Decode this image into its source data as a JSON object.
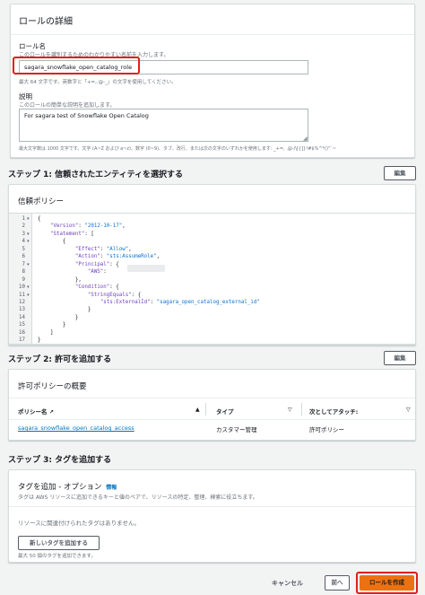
{
  "role_details": {
    "title": "ロールの詳細",
    "role_name_label": "ロール名",
    "role_name_desc": "このロールを識別するためのわかりやすい名前を入力します。",
    "role_name_value": "sagara_snowflake_open_catalog_role",
    "role_name_hint": "最大 64 文字です。英数字と「+=,.@-_」の文字を使用してください。",
    "description_label": "説明",
    "description_desc": "このロールの簡単な説明を追加します。",
    "description_value": "For sagara test of Snowflake Open Catalog",
    "description_hint": "最大文字数は 1000 文字です。文字 (A~Z および a~z)、数字 (0~9)、タブ、改行、または次の文字のいずれかを使用します: _+=, .@-/\\[{]}!#$%^*()\"`~"
  },
  "step1": {
    "title": "ステップ 1: 信頼されたエンティティを選択する",
    "edit_label": "編集",
    "trust_policy_title": "信頼ポリシー",
    "code_lines": [
      {
        "n": "1",
        "fold": true,
        "text": "{"
      },
      {
        "n": "2",
        "fold": false,
        "text": "    \"Version\": \"2012-10-17\","
      },
      {
        "n": "3",
        "fold": true,
        "text": "    \"Statement\": ["
      },
      {
        "n": "4",
        "fold": true,
        "text": "        {"
      },
      {
        "n": "5",
        "fold": false,
        "text": "            \"Effect\": \"Allow\","
      },
      {
        "n": "6",
        "fold": false,
        "text": "            \"Action\": \"sts:AssumeRole\","
      },
      {
        "n": "7",
        "fold": true,
        "text": "            \"Principal\": {"
      },
      {
        "n": "8",
        "fold": false,
        "text": "                \"AWS\": "
      },
      {
        "n": "9",
        "fold": false,
        "text": "            },"
      },
      {
        "n": "10",
        "fold": true,
        "text": "            \"Condition\": {"
      },
      {
        "n": "11",
        "fold": true,
        "text": "                \"StringEquals\": {"
      },
      {
        "n": "12",
        "fold": false,
        "text": "                    \"sts:ExternalId\": \"sagara_open_catalog_external_id\""
      },
      {
        "n": "13",
        "fold": false,
        "text": "                }"
      },
      {
        "n": "14",
        "fold": false,
        "text": "            }"
      },
      {
        "n": "15",
        "fold": false,
        "text": "        }"
      },
      {
        "n": "16",
        "fold": false,
        "text": "    ]"
      },
      {
        "n": "17",
        "fold": false,
        "text": "}"
      }
    ]
  },
  "step2": {
    "title": "ステップ 2: 許可を追加する",
    "edit_label": "編集",
    "summary_title": "許可ポリシーの概要",
    "columns": [
      "ポリシー名",
      "タイプ",
      "次としてアタッチ:"
    ],
    "rows": [
      {
        "name": "sagara_snowflake_open_catalog_access",
        "type": "カスタマー管理",
        "attached_as": "許可ポリシー"
      }
    ]
  },
  "step3": {
    "title": "ステップ 3: タグを追加する",
    "tags_title": "タグを追加 - オプション",
    "info_label": "情報",
    "tags_desc": "タグは AWS リソースに追加できるキーと値のペアで、リソースの特定、整理、検索に役立ちます。",
    "no_tags": "リソースに関連付けられたタグはありません。",
    "add_tag_label": "新しいタグを追加する",
    "tag_limit": "最大 50 個のタグを追加できます。"
  },
  "footer": {
    "cancel_label": "キャンセル",
    "back_label": "前へ",
    "create_label": "ロールを作成"
  },
  "colors": {
    "primary": "#ec7211",
    "highlight": "#e0201b",
    "link": "#0073bb"
  }
}
